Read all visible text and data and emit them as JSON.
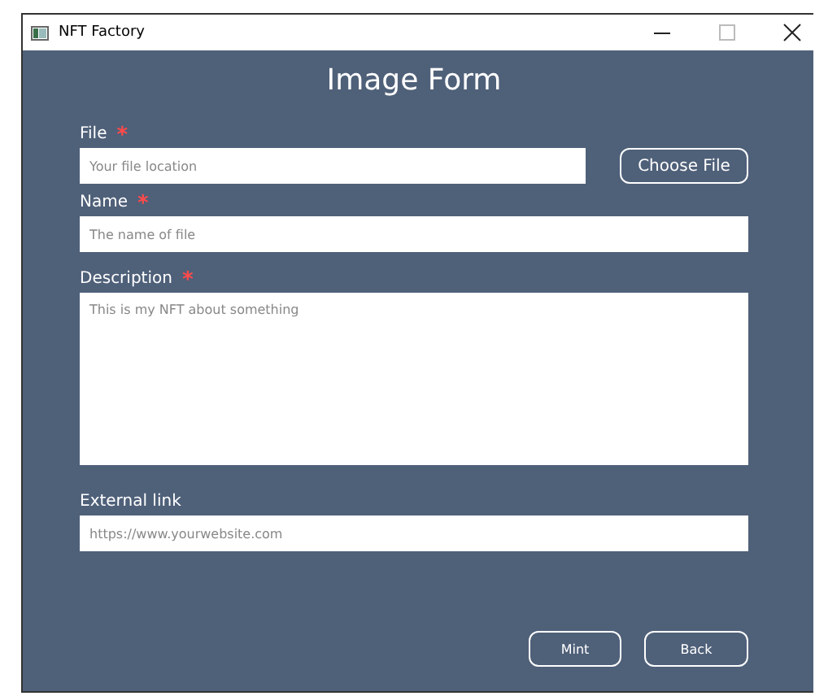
{
  "window": {
    "title": "NFT Factory"
  },
  "form": {
    "title": "Image Form",
    "fields": [
      {
        "kind": "file",
        "label": "File",
        "required_mark": "*",
        "placeholder": "Your file location",
        "button": "Choose File"
      },
      {
        "kind": "text",
        "label": "Name",
        "required_mark": "*",
        "placeholder": "The name of file"
      },
      {
        "kind": "textarea",
        "label": "Description",
        "required_mark": "*",
        "placeholder": "This is my NFT about something"
      },
      {
        "kind": "text",
        "label": "External link",
        "placeholder": "https://www.yourwebsite.com"
      }
    ],
    "buttons": [
      "Mint",
      "Back"
    ]
  }
}
